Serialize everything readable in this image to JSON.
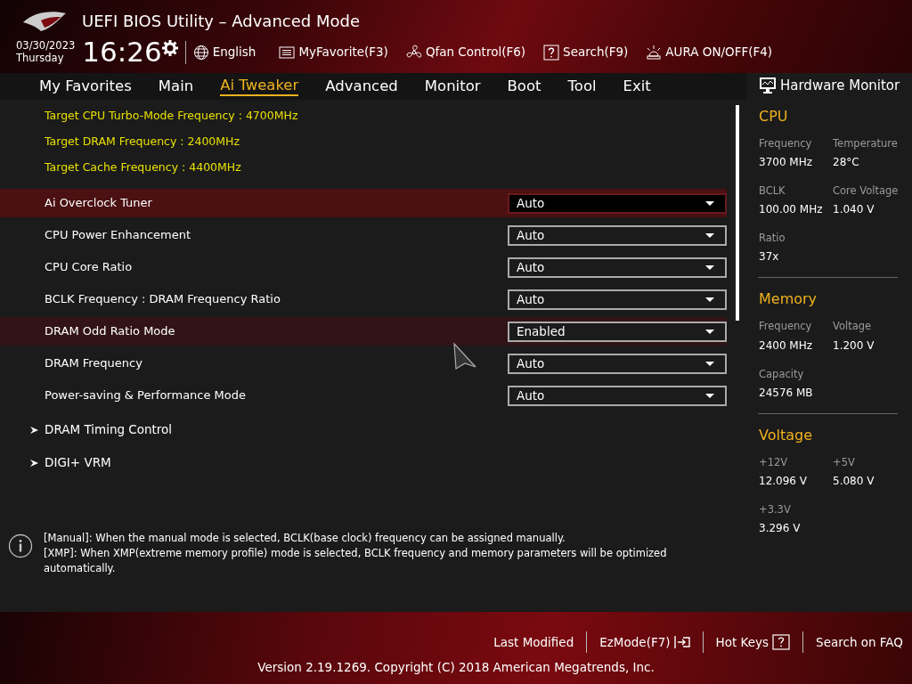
{
  "window": {
    "title": "UEFI BIOS Utility – Advanced Mode"
  },
  "header": {
    "date": "03/30/2023",
    "day": "Thursday",
    "time": "16:26",
    "tools": [
      {
        "kind": "language",
        "label": "English"
      },
      {
        "kind": "favorite",
        "label": "MyFavorite(F3)"
      },
      {
        "kind": "fan",
        "label": "Qfan Control(F6)"
      },
      {
        "kind": "search",
        "label": "Search(F9)"
      },
      {
        "kind": "aura",
        "label": "AURA ON/OFF(F4)"
      }
    ]
  },
  "tabs": [
    {
      "label": "My Favorites",
      "selected": false
    },
    {
      "label": "Main",
      "selected": false
    },
    {
      "label": "Ai Tweaker",
      "selected": true
    },
    {
      "label": "Advanced",
      "selected": false
    },
    {
      "label": "Monitor",
      "selected": false
    },
    {
      "label": "Boot",
      "selected": false
    },
    {
      "label": "Tool",
      "selected": false
    },
    {
      "label": "Exit",
      "selected": false
    }
  ],
  "settings": [
    {
      "kind": "info",
      "label": "Target CPU Turbo-Mode Frequency : 4700MHz"
    },
    {
      "kind": "info",
      "label": "Target DRAM Frequency : 2400MHz"
    },
    {
      "kind": "info",
      "label": "Target Cache Frequency : 4400MHz"
    },
    {
      "kind": "dropdown",
      "label": "Ai Overclock Tuner",
      "value": "Auto",
      "selected": true,
      "hovered": false
    },
    {
      "kind": "dropdown",
      "label": "CPU Power Enhancement",
      "value": "Auto",
      "selected": false,
      "hovered": false
    },
    {
      "kind": "dropdown",
      "label": "CPU Core Ratio",
      "value": "Auto",
      "selected": false,
      "hovered": false
    },
    {
      "kind": "dropdown",
      "label": "BCLK Frequency : DRAM Frequency Ratio",
      "value": "Auto",
      "selected": false,
      "hovered": false
    },
    {
      "kind": "dropdown",
      "label": "DRAM Odd Ratio Mode",
      "value": "Enabled",
      "selected": false,
      "hovered": true
    },
    {
      "kind": "dropdown",
      "label": "DRAM Frequency",
      "value": "Auto",
      "selected": false,
      "hovered": false
    },
    {
      "kind": "dropdown",
      "label": "Power-saving & Performance Mode",
      "value": "Auto",
      "selected": false,
      "hovered": false
    },
    {
      "kind": "submenu",
      "label": "DRAM Timing Control"
    },
    {
      "kind": "submenu",
      "label": "DIGI+ VRM"
    }
  ],
  "help": {
    "paragraphs": [
      "[Manual]: When the manual mode is selected, BCLK(base clock) frequency can be assigned manually.",
      "[XMP]: When XMP(extreme memory profile) mode is selected, BCLK frequency and memory parameters will be optimized automatically."
    ]
  },
  "hardware_monitor": {
    "title": "Hardware Monitor",
    "sections": [
      {
        "title": "CPU",
        "items": [
          {
            "label": "Frequency",
            "value": "3700 MHz"
          },
          {
            "label": "Temperature",
            "value": "28°C"
          },
          {
            "label": "BCLK",
            "value": "100.00 MHz"
          },
          {
            "label": "Core Voltage",
            "value": "1.040 V"
          },
          {
            "label": "Ratio",
            "value": "37x"
          }
        ]
      },
      {
        "title": "Memory",
        "items": [
          {
            "label": "Frequency",
            "value": "2400 MHz"
          },
          {
            "label": "Voltage",
            "value": "1.200 V"
          },
          {
            "label": "Capacity",
            "value": "24576 MB"
          }
        ]
      },
      {
        "title": "Voltage",
        "items": [
          {
            "label": "+12V",
            "value": "12.096 V"
          },
          {
            "label": "+5V",
            "value": "5.080 V"
          },
          {
            "label": "+3.3V",
            "value": "3.296 V"
          }
        ]
      }
    ]
  },
  "footer": {
    "actions": [
      {
        "kind": "text",
        "label": "Last Modified"
      },
      {
        "kind": "ezmode",
        "label": "EzMode(F7)"
      },
      {
        "kind": "hotkeys",
        "label": "Hot Keys"
      },
      {
        "kind": "text",
        "label": "Search on FAQ"
      }
    ],
    "version": "Version 2.19.1269. Copyright (C) 2018 American Megatrends, Inc."
  }
}
